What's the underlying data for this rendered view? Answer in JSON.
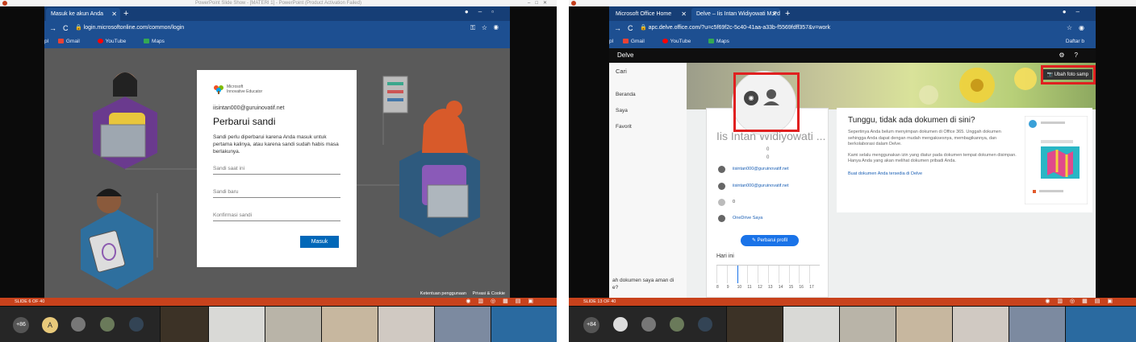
{
  "left": {
    "ppt_title": "PowerPoint Slide Show - [MATERI 1] - PowerPoint (Product Activation Failed)",
    "tab_label": "Masuk ke akun Anda",
    "url": "login.microsoftonline.com/common/login",
    "bookmarks": [
      "Gmail",
      "YouTube",
      "Maps"
    ],
    "bookmark_prefix": "pl",
    "logo_line1": "Microsoft",
    "logo_line2": "Innovative Educator",
    "email": "iisintan000@guruinovatif.net",
    "heading": "Perbarui sandi",
    "description": "Sandi perlu diperbarui karena Anda masuk untuk pertama kalinya, atau karena sandi sudah habis masa berlakunya.",
    "field_current": "Sandi saat ini",
    "field_new": "Sandi baru",
    "field_confirm": "Konfirmasi sandi",
    "submit_label": "Masuk",
    "footer_terms": "Ketentuan penggunaan",
    "footer_privacy": "Privasi & Cookie",
    "slide_status": "SLIDE 6 OF 40",
    "participants_more": "+86",
    "avatar_letter": "A"
  },
  "right": {
    "tab1_label": "Microsoft Office Home",
    "tab2_label": "Delve – Iis Intan Widiyowati M.Pd",
    "url": "apc.delve.office.com/?u=c5f69f2c-5c40-41aa-a33b-f5569fdff357&v=work",
    "bookmarks": [
      "Gmail",
      "YouTube",
      "Maps"
    ],
    "bookmark_prefix": "pl",
    "bookmarks_right": "Daftar b",
    "app_name": "Delve",
    "search_label": "Cari",
    "nav_items": [
      "Beranda",
      "Saya",
      "Favorit"
    ],
    "side_bottom_text": "ah dokumen saya aman di e?",
    "change_photo_label": "Ubah foto samp",
    "profile_name": "Iis Intan Widiyowati ...",
    "count1": "0",
    "count2": "0",
    "profile_email": "iisintan000@guruinovatif.net",
    "profile_chat": "iisintan000@guruinovatif.net",
    "profile_phone": "0",
    "onedrive_label": "OneDrive Saya",
    "update_profile_label": "Perbarui profil",
    "today_label": "Hari ini",
    "timeline_hours": [
      "8",
      "9",
      "10",
      "11",
      "12",
      "13",
      "14",
      "15",
      "16",
      "17"
    ],
    "info_title": "Tunggu, tidak ada dokumen di sini?",
    "info_p1": "Sepertinya Anda belum menyimpan dokumen di Office 365. Unggah dokumen sehingga Anda dapat dengan mudah mengaksesnya, membagikannya, dan berkolaborasi dalam Delve.",
    "info_p2": "Kami selalu menggunakan izin yang diatur pada dokumen tempat dokumen disimpan. Hanya Anda yang akan melihat dokumen pribadi Anda.",
    "info_link": "Buat dokumen Anda tersedia di Delve",
    "slide_status": "SLIDE 13 OF 40",
    "participants_more": "+84"
  },
  "colors": {
    "chrome_blue": "#1d4f91",
    "status_orange": "#c8421c",
    "ms_blue": "#0067b8",
    "highlight_red": "#e02020"
  }
}
